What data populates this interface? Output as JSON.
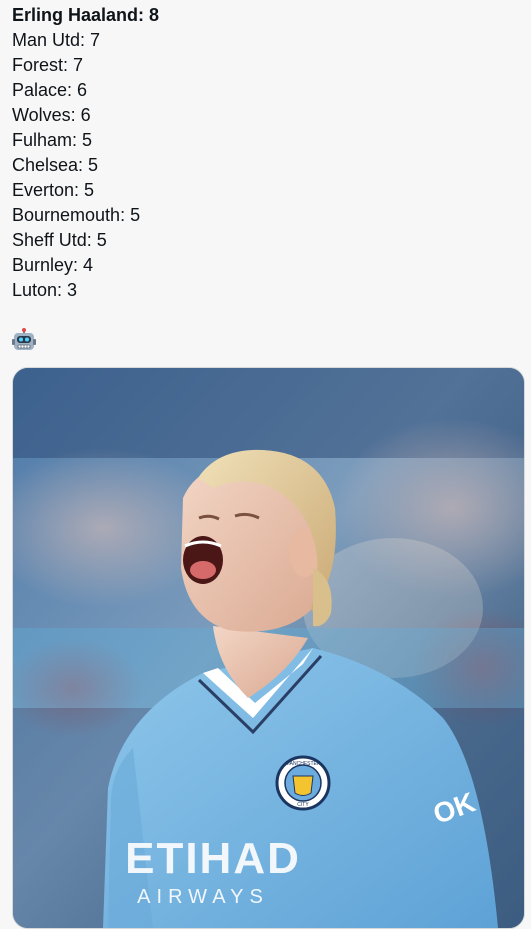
{
  "tweet": {
    "lines": [
      "Erling Haaland: 8",
      "Man Utd: 7",
      "Forest: 7",
      "Palace: 6",
      "Wolves: 6",
      "Fulham: 5",
      "Chelsea: 5",
      "Everton: 5",
      "Bournemouth: 5",
      "Sheff Utd: 5",
      "Burnley: 4",
      "Luton: 3"
    ],
    "emoji_icon": "robot-face-emoji"
  },
  "media": {
    "shirt_sponsor_line1": "ETIHAD",
    "shirt_sponsor_line2": "AIRWAYS",
    "crest_text_top": "MANCHESTER",
    "crest_text_bottom": "CITY",
    "sleeve_logo": "OK"
  }
}
